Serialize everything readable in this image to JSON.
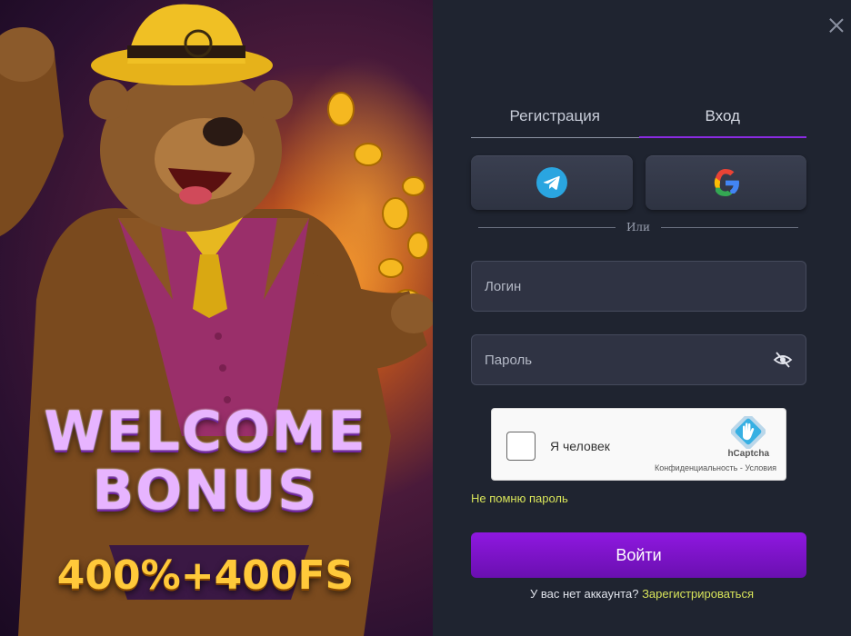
{
  "promo": {
    "headline_line1": "WELCOME",
    "headline_line2": "BONUS",
    "offer": "400%+400FS",
    "mascot": "bear in yellow hat with coins"
  },
  "tabs": [
    {
      "label": "Регистрация",
      "active": false
    },
    {
      "label": "Вход",
      "active": true
    }
  ],
  "social": {
    "telegram_icon": "telegram-icon",
    "google_icon": "google-icon"
  },
  "divider_text": "Или",
  "login": {
    "placeholder": "Логин",
    "value": ""
  },
  "password": {
    "placeholder": "Пароль",
    "value": "",
    "toggle_icon": "eye-slash-icon"
  },
  "captcha": {
    "label": "Я человек",
    "brand": "hCaptcha",
    "links": "Конфиденциальность - Условия"
  },
  "forgot_password": "Не помню пароль",
  "submit_label": "Войти",
  "signup_prompt": "У вас нет аккаунта?",
  "signup_link": "Зарегистрироваться",
  "colors": {
    "accent": "#8a2be2",
    "link": "#d8e45a",
    "panel_bg": "#1f2430",
    "field_bg": "#2f3343"
  }
}
